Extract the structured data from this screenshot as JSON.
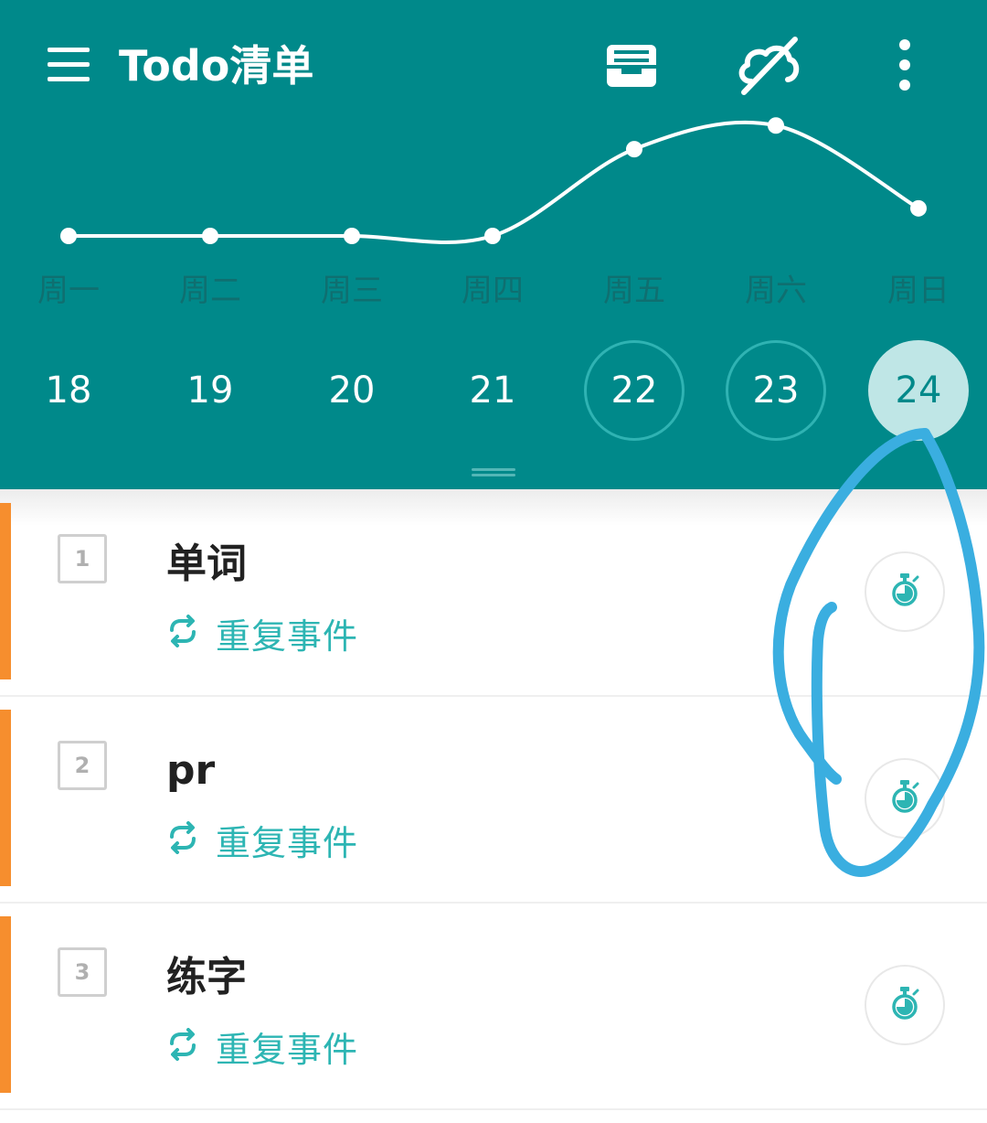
{
  "header": {
    "title": "Todo清单",
    "actions": [
      "archive-icon",
      "cloud-off-icon",
      "more-vertical-icon"
    ]
  },
  "colors": {
    "header_bg": "#00898A",
    "accent": "#2DB5B3",
    "priority_bar": "#F68E2E",
    "annotation": "#3AAEE0"
  },
  "week": [
    {
      "label": "周一",
      "date": "18"
    },
    {
      "label": "周二",
      "date": "19"
    },
    {
      "label": "周三",
      "date": "20"
    },
    {
      "label": "周四",
      "date": "21"
    },
    {
      "label": "周五",
      "date": "22"
    },
    {
      "label": "周六",
      "date": "23"
    },
    {
      "label": "周日",
      "date": "24"
    }
  ],
  "chart_data": {
    "type": "line",
    "categories": [
      "周一",
      "周二",
      "周三",
      "周四",
      "周五",
      "周六",
      "周日"
    ],
    "values": [
      0,
      0,
      0,
      0,
      1.1,
      1.4,
      0.35
    ],
    "ylim": [
      0,
      1.6
    ],
    "grid": false
  },
  "tasks": [
    {
      "index": "1",
      "title": "单词",
      "repeat_label": "重复事件"
    },
    {
      "index": "2",
      "title": "pr",
      "repeat_label": "重复事件"
    },
    {
      "index": "3",
      "title": "练字",
      "repeat_label": "重复事件"
    }
  ]
}
